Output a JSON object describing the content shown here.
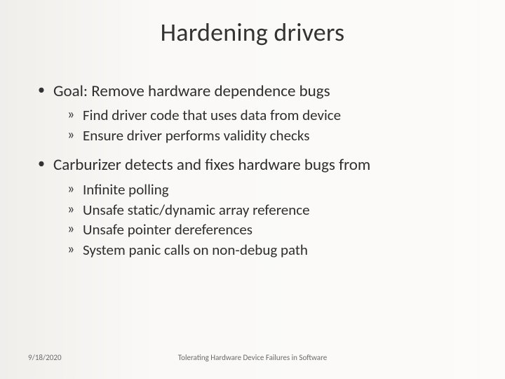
{
  "title": "Hardening drivers",
  "bullets": [
    {
      "text": "Goal: Remove hardware dependence bugs",
      "sub": [
        "Find driver code that uses data from device",
        "Ensure driver performs validity checks"
      ]
    },
    {
      "text": "Carburizer detects and fixes hardware bugs from",
      "sub": [
        "Infinite polling",
        "Unsafe static/dynamic array reference",
        "Unsafe pointer dereferences",
        "System panic calls on non-debug path"
      ]
    }
  ],
  "footer": {
    "date": "9/18/2020",
    "caption": "Tolerating Hardware Device Failures in Software"
  }
}
